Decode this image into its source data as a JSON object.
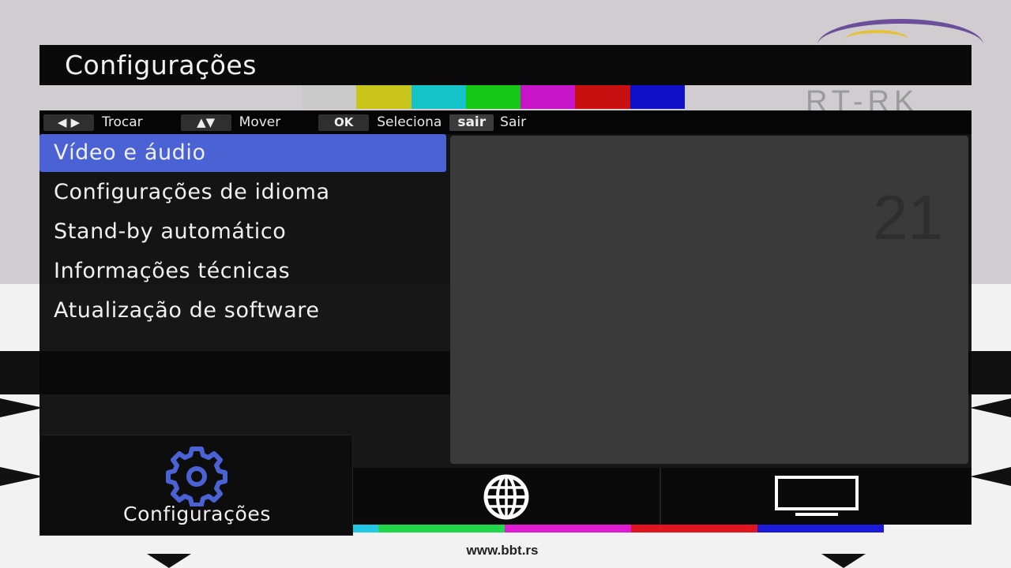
{
  "title": "Configurações",
  "hints": [
    {
      "key": "◀ ▶",
      "label": "Trocar"
    },
    {
      "key": "▲▼",
      "label": "Mover"
    },
    {
      "key": "OK",
      "label": "Seleciona"
    },
    {
      "key": "sair",
      "label": "Sair"
    }
  ],
  "menu": {
    "selected_index": 0,
    "items": [
      {
        "label": "Vídeo e áudio"
      },
      {
        "label": "Configurações de idioma"
      },
      {
        "label": "Stand-by automático"
      },
      {
        "label": "Informações técnicas"
      },
      {
        "label": "Atualização de software"
      }
    ]
  },
  "tabs": [
    {
      "icon": "gear-icon",
      "label": "Configurações",
      "active": true
    },
    {
      "icon": "globe-icon",
      "label": "",
      "active": false
    },
    {
      "icon": "tv-icon",
      "label": "",
      "active": false
    }
  ],
  "background": {
    "logo": "RT-RK",
    "channel_number": "21",
    "footer_url": "www.bbt.rs"
  },
  "colors": {
    "selection": "#4a62d3",
    "icon_blue": "#4a62d3",
    "panel": "#0a0a0a",
    "detail_pane": "#3a3a3a"
  }
}
